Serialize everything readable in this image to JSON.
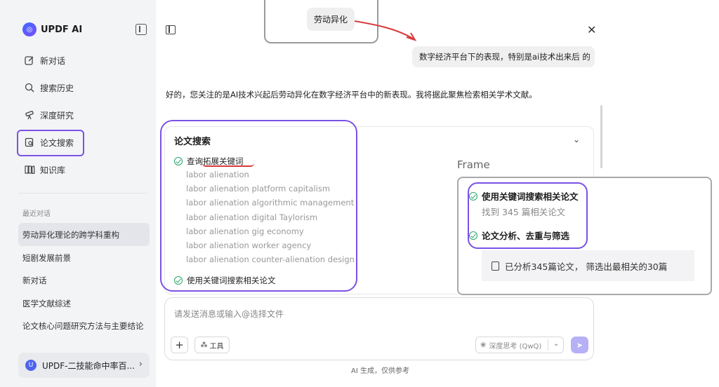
{
  "sidebar": {
    "app_name": "UPDF AI",
    "logo_glyph": "◎",
    "nav": [
      {
        "label": "新对话",
        "icon": "edit-icon"
      },
      {
        "label": "搜索历史",
        "icon": "search-icon"
      },
      {
        "label": "深度研究",
        "icon": "telescope-icon"
      },
      {
        "label": "论文搜索",
        "icon": "paper-search-icon",
        "active": true
      },
      {
        "label": "知识库",
        "icon": "library-icon"
      }
    ],
    "recent_label": "最近对话",
    "recent": [
      "劳动异化理论的跨学科重构",
      "短剧发展前景",
      "新对话",
      "医学文献综述",
      "论文核心问题研究方法与主要结论"
    ],
    "user": {
      "name": "UPDF-二技能命中率百...",
      "avatar_glyph": "U"
    }
  },
  "chat": {
    "annotation_bubble": "劳动异化",
    "user_message": "数字经济平台下的表现，特别是ai技术出来后 的",
    "ai_reply": "好的，您关注的是AI技术兴起后劳动异化在数字经济平台中的新表现。我将据此聚焦检索相关学术文献。",
    "search_card": {
      "title": "论文搜索",
      "step1_prefix": "查询",
      "step1_highlight": "拓展关键词",
      "keywords": [
        "labor alienation",
        "labor alienation platform capitalism",
        "labor alienation algorithmic management",
        "labor alienation digital Taylorism",
        "labor alienation gig economy",
        "labor alienation worker agency",
        "labor alienation counter-alienation design"
      ],
      "step2": "使用关键词搜索相关论文"
    },
    "frame": {
      "label": "Frame",
      "step1": "使用关键词搜索相关论文",
      "step1_sub": "找到 345 篇相关论文",
      "step2": "论文分析、去重与筛选",
      "result": "已分析345篇论文， 筛选出最相关的30篇"
    }
  },
  "composer": {
    "placeholder": "请发送消息或输入@选择文件",
    "plus": "+",
    "tools_icon": "⁂",
    "tools_label": "工具",
    "model_icon": "❀",
    "model": "深度思考 (QwQ)",
    "model_chevron": "⌄",
    "send_icon": "➤",
    "footnote": "AI 生成，仅供参考"
  },
  "colors": {
    "accent_purple": "#7b52e6",
    "annotation_red": "#d8393a",
    "check_green": "#2aa66a",
    "send_button": "#b6b0f6"
  }
}
